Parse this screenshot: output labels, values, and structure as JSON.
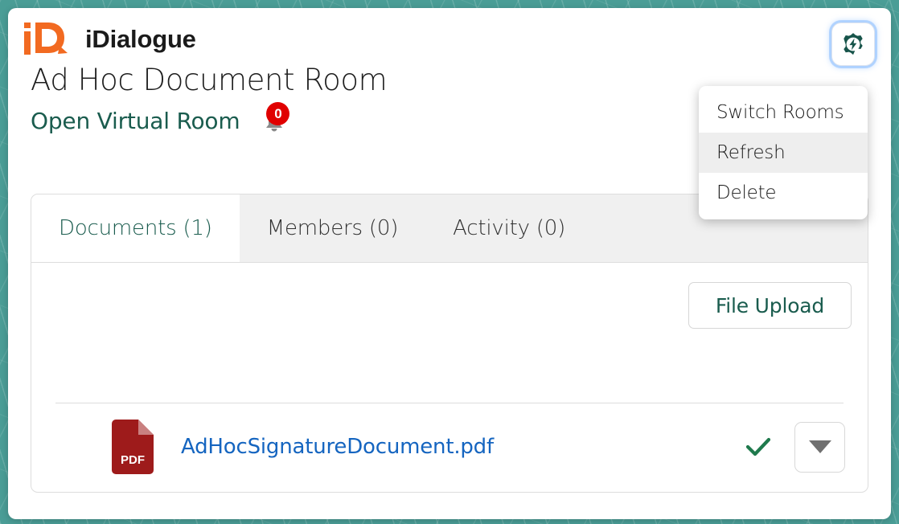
{
  "brand": {
    "name": "iDialogue",
    "logo_icon": "idialogue-logo-icon",
    "logo_color": "#f26a21"
  },
  "header": {
    "page_title": "Ad Hoc Document Room",
    "virtual_room_link": "Open Virtual Room",
    "notification_icon": "bell-icon",
    "notification_count": "0",
    "notification_color": "#e00000",
    "settings_icon": "gear-bolt-icon",
    "settings_icon_color": "#17544a"
  },
  "settings_menu": {
    "open": true,
    "items": [
      {
        "label": "Switch Rooms",
        "highlighted": false
      },
      {
        "label": "Refresh",
        "highlighted": true
      },
      {
        "label": "Delete",
        "highlighted": false
      }
    ]
  },
  "tabs": [
    {
      "label": "Documents (1)",
      "selected": true
    },
    {
      "label": "Members (0)",
      "selected": false
    },
    {
      "label": "Activity (0)",
      "selected": false
    }
  ],
  "toolbar": {
    "upload_label": "File Upload"
  },
  "documents": [
    {
      "file_icon": "pdf-file-icon",
      "file_icon_label": "PDF",
      "name": "AdHocSignatureDocument.pdf",
      "status_icon": "checkmark-icon",
      "status_color": "#1f7a4d",
      "menu_icon": "caret-down-icon"
    }
  ],
  "theme": {
    "accent_green": "#1a5c4e",
    "link_blue": "#1565c0",
    "backdrop_teal": "#4a9d96"
  }
}
